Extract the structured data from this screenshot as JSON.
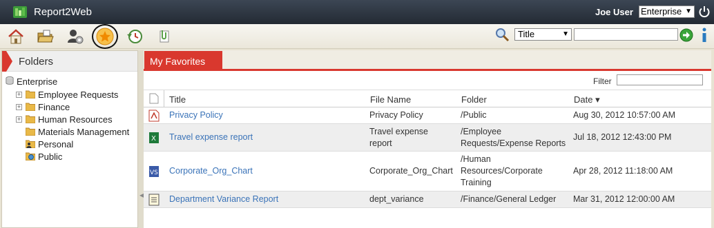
{
  "app": {
    "title": "Report2Web"
  },
  "user": {
    "name": "Joe User",
    "tenant": "Enterprise"
  },
  "toolbar": {
    "icons": [
      "home-icon",
      "open-folder-icon",
      "user-settings-icon",
      "favorites-star-icon",
      "history-clock-icon",
      "attachment-icon"
    ],
    "search_type": "Title",
    "search_value": ""
  },
  "sidebar": {
    "title": "Folders",
    "root": "Enterprise",
    "items": [
      {
        "label": "Employee Requests",
        "expandable": true,
        "icon": "folder-icon"
      },
      {
        "label": "Finance",
        "expandable": true,
        "icon": "folder-icon"
      },
      {
        "label": "Human Resources",
        "expandable": true,
        "icon": "folder-icon"
      },
      {
        "label": "Materials Management",
        "expandable": false,
        "icon": "folder-icon"
      },
      {
        "label": "Personal",
        "expandable": false,
        "icon": "personal-folder-icon"
      },
      {
        "label": "Public",
        "expandable": false,
        "icon": "public-folder-icon"
      }
    ]
  },
  "main": {
    "tab": "My Favorites",
    "filter_label": "Filter",
    "columns": {
      "title": "Title",
      "file_name": "File Name",
      "folder": "Folder",
      "date": "Date ▾"
    },
    "rows": [
      {
        "type": "pdf-icon",
        "title": "Privacy Policy",
        "file_name": "Privacy Policy",
        "folder": "/Public",
        "date": "Aug 30, 2012 10:57:00 AM"
      },
      {
        "type": "excel-icon",
        "title": "Travel expense report",
        "file_name": "Travel expense report",
        "folder": "/Employee Requests/Expense Reports",
        "date": "Jul 18, 2012 12:43:00 PM"
      },
      {
        "type": "visio-icon",
        "title": "Corporate_Org_Chart",
        "file_name": "Corporate_Org_Chart",
        "folder": "/Human Resources/Corporate Training",
        "date": "Apr 28, 2012 11:18:00 AM"
      },
      {
        "type": "text-report-icon",
        "title": "Department Variance Report",
        "file_name": "dept_variance",
        "folder": "/Finance/General Ledger",
        "date": "Mar 31, 2012 12:00:00 AM"
      }
    ]
  },
  "colors": {
    "accent": "#d9382e",
    "link": "#3a73b8",
    "topbar": "#2b333d"
  }
}
